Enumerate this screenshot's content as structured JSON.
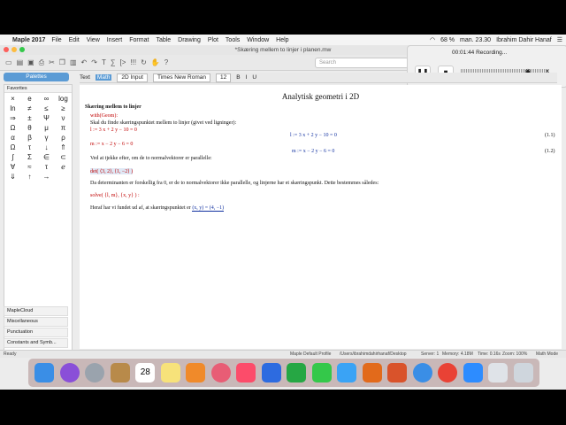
{
  "menubar": {
    "app": "Maple 2017",
    "items": [
      "File",
      "Edit",
      "View",
      "Insert",
      "Format",
      "Table",
      "Drawing",
      "Plot",
      "Tools",
      "Window",
      "Help"
    ],
    "battery": "68 %",
    "clock": "man. 23.30",
    "user": "Ibrahim Dahir Hanaf"
  },
  "window": {
    "title": "*Skæring mellem to linjer i planen.mw"
  },
  "toolbar": {
    "search_placeholder": "Search"
  },
  "recording": {
    "time": "00:01:44 Recording..."
  },
  "palettes": {
    "header": "Palettes",
    "favorites": "Favorites",
    "symbols": [
      "×",
      "e",
      "∞",
      "log",
      "ln",
      "≠",
      "≤",
      "≥",
      "⇒",
      "±",
      "Ψ",
      "ν",
      "Ω",
      "θ",
      "μ",
      "π",
      "α",
      "β",
      "γ",
      "ρ",
      "Ω",
      "τ",
      "↓",
      "⇑",
      "∫",
      "Σ",
      "∈",
      "⊂",
      "∀",
      "≈",
      "τ",
      "ℯ",
      "⇓",
      "↑",
      "→"
    ],
    "bottom": [
      "MapleCloud",
      "Miscellaneous",
      "Punctuation",
      "Constants and Symb..."
    ]
  },
  "contextbar": {
    "mode_text": "Text",
    "mode_math": "Math",
    "input_mode": "2D Input",
    "font": "Times New Roman",
    "size": "12"
  },
  "document": {
    "title": "Analytisk geometri i 2D",
    "section": "Skæring mellem to linjer",
    "restart": "with(Geom):",
    "intro": "Skal du finde skæringspunktet mellem to linjer (givet ved ligninger):",
    "eq_l_input": "l := 3 x + 2 y − 10 = 0",
    "eq_l_output": "l := 3 x + 2 y − 10 = 0",
    "eq_l_label": "(1.1)",
    "eq_m_input": "m := x − 2 y − 6 = 0",
    "eq_m_output": "m := x − 2 y − 6 = 0",
    "eq_m_label": "(1.2)",
    "check_text": "Ved at tjekke efter, om de to normalvektorer er parallelle:",
    "det_cmd": "det( ⟨3, 2⟩, ⟨1, −2⟩ )",
    "det_result": "Da determinanten er forskellig fra 0, er de to normalvektorer ikke parallelle, og linjerne har et skæringspunkt. Dette bestemmes således:",
    "solve_cmd": "solve( {l, m}, {x, y} ) :",
    "conclusion": "Heraf har vi fundet ud af, at skæringspunktet er",
    "conclusion_math": "(x, y) = (4, −1)"
  },
  "status": {
    "ready": "Ready",
    "profile": "Maple Default Profile",
    "path": "/Users/ibrahimdahirhanaf/Desktop",
    "server": "Server: 1",
    "memory": "Memory: 4.18M",
    "time": "Time: 0.16s",
    "zoom": "Zoom: 100%",
    "mode": "Math Mode"
  },
  "dock": {
    "icons": [
      "finder-icon",
      "siri-icon",
      "launchpad-icon",
      "notes-icon",
      "calendar-icon",
      "stickies-icon",
      "books-icon",
      "photos-icon",
      "itunes-icon",
      "keynote-icon",
      "numbers-icon",
      "facetime-icon",
      "messages-icon",
      "ibooks-icon",
      "maple-icon",
      "safari-icon",
      "chrome-icon",
      "zoom-icon",
      "screenshot-icon",
      "trash-icon"
    ],
    "calendar_day": "28"
  }
}
